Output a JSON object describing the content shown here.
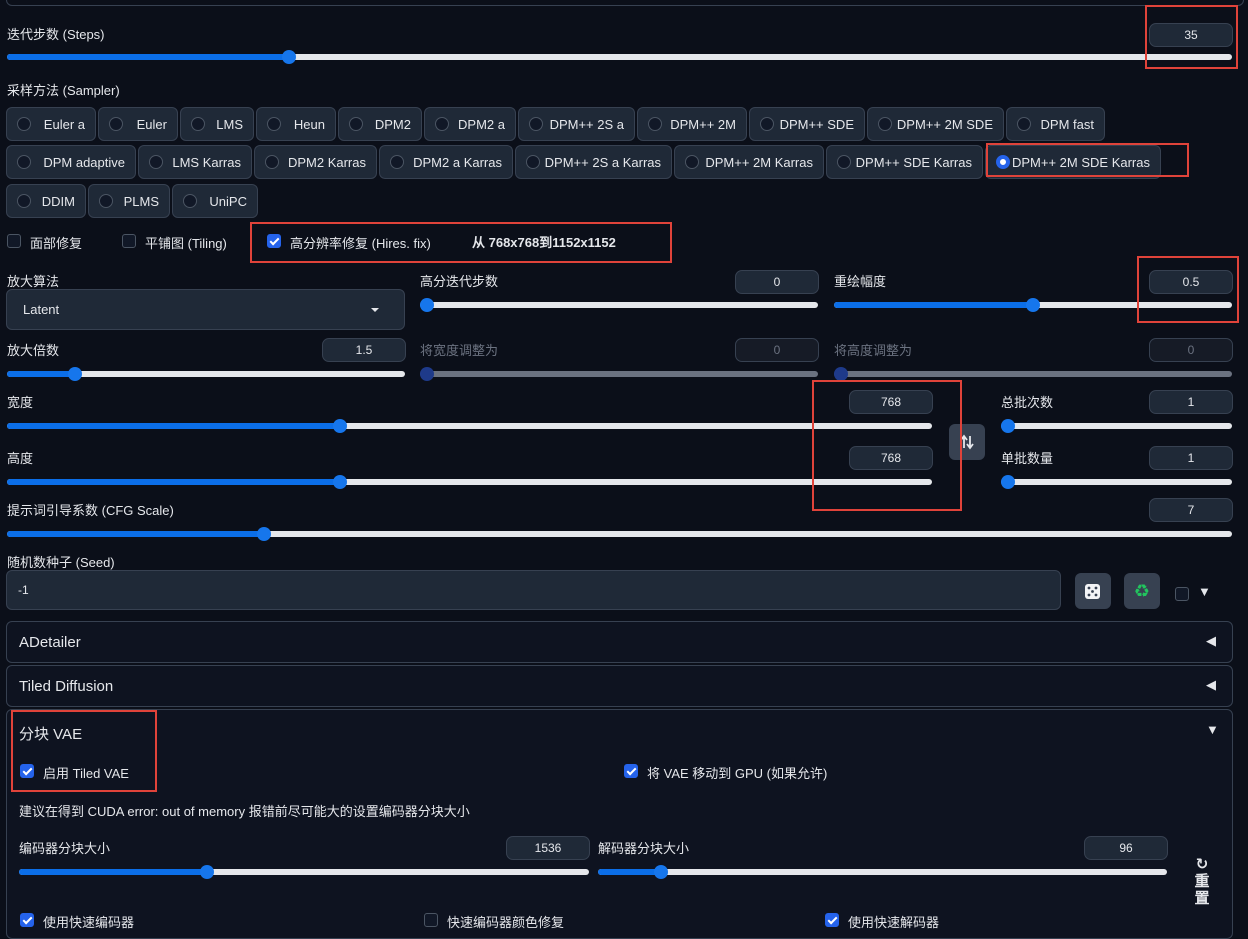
{
  "steps": {
    "label": "迭代步数 (Steps)",
    "value": "35",
    "fraction": 0.23
  },
  "sampler": {
    "label": "采样方法 (Sampler)",
    "selected": "DPM++ 2M SDE Karras",
    "options": [
      "Euler a",
      "Euler",
      "LMS",
      "Heun",
      "DPM2",
      "DPM2 a",
      "DPM++ 2S a",
      "DPM++ 2M",
      "DPM++ SDE",
      "DPM++ 2M SDE",
      "DPM fast",
      "DPM adaptive",
      "LMS Karras",
      "DPM2 Karras",
      "DPM2 a Karras",
      "DPM++ 2S a Karras",
      "DPM++ 2M Karras",
      "DPM++ SDE Karras",
      "DPM++ 2M SDE Karras",
      "DDIM",
      "PLMS",
      "UniPC"
    ]
  },
  "checks": {
    "face_restore": "面部修复",
    "tiling": "平铺图 (Tiling)",
    "hires_fix": "高分辨率修复 (Hires. fix)",
    "hires_note": "从 768x768到1152x1152"
  },
  "hires": {
    "upscaler_label": "放大算法",
    "upscaler_value": "Latent",
    "hires_steps_label": "高分迭代步数",
    "hires_steps_value": "0",
    "denoise_label": "重绘幅度",
    "denoise_value": "0.5",
    "denoise_fraction": 0.5,
    "scale_label": "放大倍数",
    "scale_value": "1.5",
    "scale_fraction": 0.17,
    "resize_w_label": "将宽度调整为",
    "resize_w_value": "0",
    "resize_h_label": "将高度调整为",
    "resize_h_value": "0"
  },
  "size": {
    "width_label": "宽度",
    "width_value": "768",
    "width_fraction": 0.36,
    "height_label": "高度",
    "height_value": "768",
    "height_fraction": 0.36,
    "swap_icon": "swap-vertical-icon",
    "batch_count_label": "总批次数",
    "batch_count_value": "1",
    "batch_size_label": "单批数量",
    "batch_size_value": "1"
  },
  "cfg": {
    "label": "提示词引导系数 (CFG Scale)",
    "value": "7",
    "fraction": 0.21
  },
  "seed": {
    "label": "随机数种子 (Seed)",
    "value": "-1",
    "dice_icon": "dice-icon",
    "recycle_icon": "recycle-icon"
  },
  "accordions": {
    "adetailer": "ADetailer",
    "tiled_diffusion": "Tiled Diffusion",
    "tiled_vae": "分块 VAE"
  },
  "tiled_vae": {
    "enable_label": "启用 Tiled VAE",
    "move_gpu_label": "将 VAE 移动到 GPU (如果允许)",
    "hint": "建议在得到 CUDA error: out of memory 报错前尽可能大的设置编码器分块大小",
    "encoder_label": "编码器分块大小",
    "encoder_value": "1536",
    "encoder_fraction": 0.33,
    "decoder_label": "解码器分块大小",
    "decoder_value": "96",
    "decoder_fraction": 0.11,
    "reset_label": "↻重置",
    "bottom_1": "使用快速编码器",
    "bottom_2": "快速编码器颜色修复",
    "bottom_3": "使用快速解码器"
  },
  "colors": {
    "accent": "#2563eb",
    "highlight": "#e0433a",
    "background": "#0b0f19"
  }
}
